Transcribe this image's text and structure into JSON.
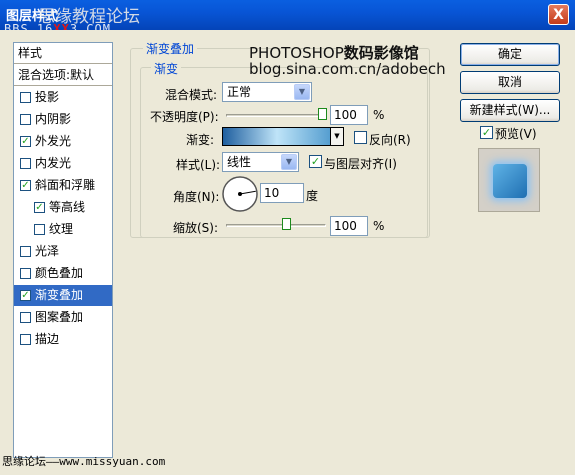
{
  "window": {
    "title": "图层样式",
    "watermark_forum": "思缘教程论坛",
    "watermark_bbs_pre": "BBS.16",
    "watermark_bbs_red": "XX",
    "watermark_bbs_post": "3.COM",
    "close_glyph": "X"
  },
  "style_list": {
    "header": "样式",
    "blend_default": "混合选项:默认",
    "items": [
      {
        "label": "投影",
        "checked": false,
        "selected": false,
        "indent": false
      },
      {
        "label": "内阴影",
        "checked": false,
        "selected": false,
        "indent": false
      },
      {
        "label": "外发光",
        "checked": true,
        "selected": false,
        "indent": false
      },
      {
        "label": "内发光",
        "checked": false,
        "selected": false,
        "indent": false
      },
      {
        "label": "斜面和浮雕",
        "checked": true,
        "selected": false,
        "indent": false
      },
      {
        "label": "等高线",
        "checked": true,
        "selected": false,
        "indent": true
      },
      {
        "label": "纹理",
        "checked": false,
        "selected": false,
        "indent": true
      },
      {
        "label": "光泽",
        "checked": false,
        "selected": false,
        "indent": false
      },
      {
        "label": "颜色叠加",
        "checked": false,
        "selected": false,
        "indent": false
      },
      {
        "label": "渐变叠加",
        "checked": true,
        "selected": true,
        "indent": false
      },
      {
        "label": "图案叠加",
        "checked": false,
        "selected": false,
        "indent": false
      },
      {
        "label": "描边",
        "checked": false,
        "selected": false,
        "indent": false
      }
    ]
  },
  "panel": {
    "outer_legend": "渐变叠加",
    "inner_legend": "渐变",
    "blend_mode_label": "混合模式:",
    "blend_mode_value": "正常",
    "opacity_label": "不透明度(P):",
    "opacity_value": "100",
    "opacity_unit": "%",
    "opacity_level": 1.0,
    "gradient_label": "渐变:",
    "reverse_label": "反向(R)",
    "reverse_checked": false,
    "style_label": "样式(L):",
    "style_value": "线性",
    "align_label": "与图层对齐(I)",
    "align_checked": true,
    "angle_label": "角度(N):",
    "angle_value": "10",
    "angle_unit": "度",
    "scale_label": "缩放(S):",
    "scale_value": "100",
    "scale_unit": "%"
  },
  "buttons": {
    "ok": "确定",
    "cancel": "取消",
    "new_style": "新建样式(W)...",
    "preview_label": "预览(V)",
    "preview_checked": true
  },
  "overlay": {
    "blog_line1_latin": "PHOTOSHOP",
    "blog_line1_cjk": "数码影像馆",
    "blog_line2": "blog.sina.com.cn/adobech",
    "footer": "思缘论坛——www.missyuan.com"
  },
  "colors": {
    "titlebar": "#0855d6",
    "selection": "#316ac5",
    "legend": "#0046d5",
    "check": "#21a121",
    "gradient_dark": "#1f5f9f",
    "gradient_light": "#bfe4f8"
  }
}
